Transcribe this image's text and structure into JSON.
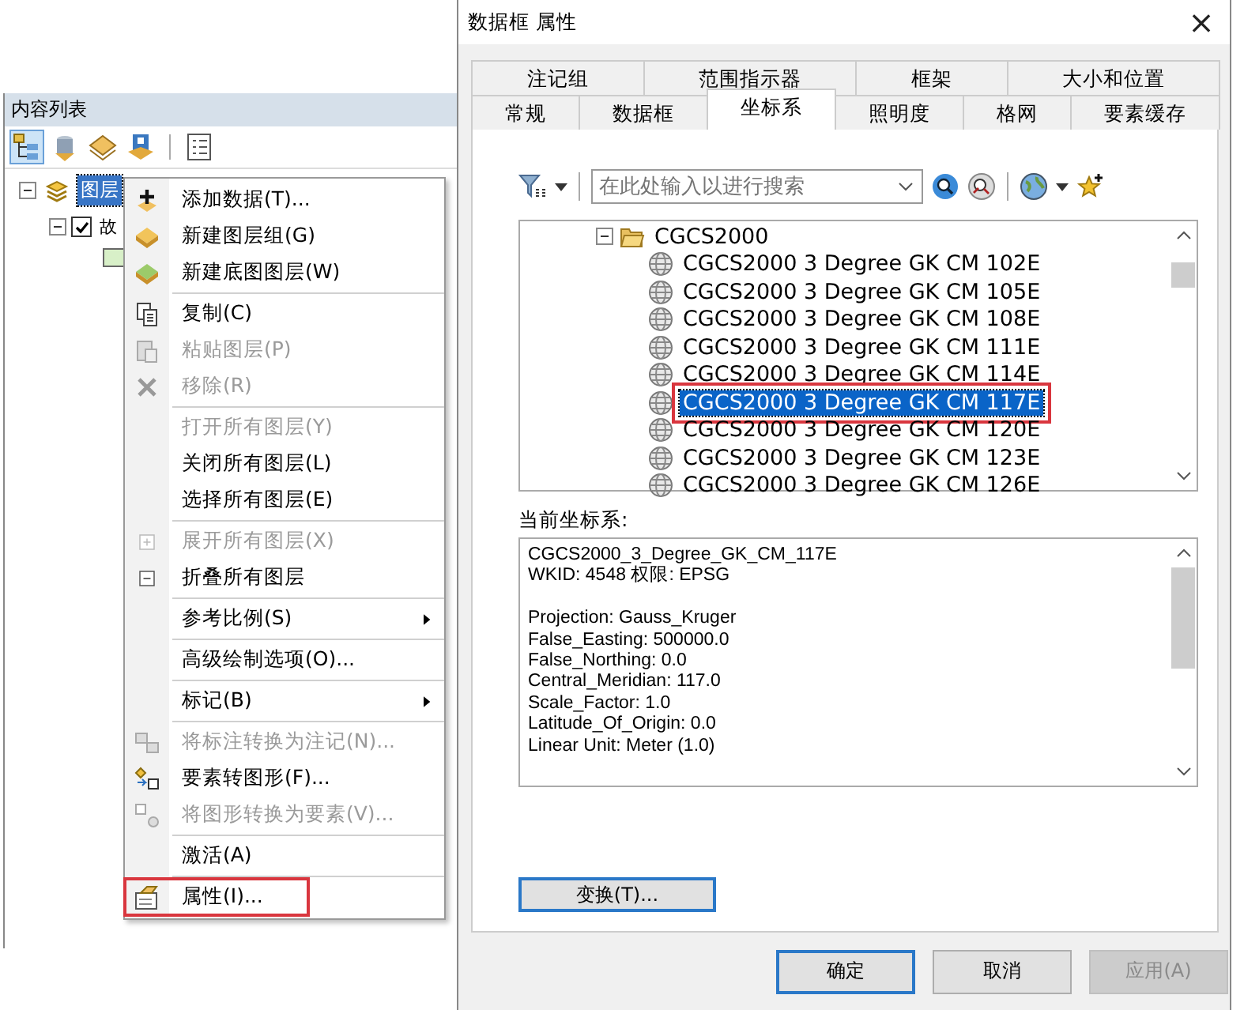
{
  "toc": {
    "title": "内容列表",
    "tree": [
      {
        "label": "图层",
        "selected": true,
        "expanded": true,
        "children": [
          {
            "label": "故",
            "checked": true,
            "expanded": true,
            "color": "#d8f0c8"
          }
        ]
      }
    ]
  },
  "context_menu": [
    {
      "kind": "item",
      "label": "添加数据(T)...",
      "disabled": false
    },
    {
      "kind": "item",
      "label": "新建图层组(G)",
      "disabled": false
    },
    {
      "kind": "item",
      "label": "新建底图图层(W)",
      "disabled": false
    },
    {
      "kind": "separator"
    },
    {
      "kind": "item",
      "label": "复制(C)",
      "disabled": false
    },
    {
      "kind": "item",
      "label": "粘贴图层(P)",
      "disabled": true
    },
    {
      "kind": "item",
      "label": "移除(R)",
      "disabled": true
    },
    {
      "kind": "separator"
    },
    {
      "kind": "item",
      "label": "打开所有图层(Y)",
      "disabled": true
    },
    {
      "kind": "item",
      "label": "关闭所有图层(L)",
      "disabled": false
    },
    {
      "kind": "item",
      "label": "选择所有图层(E)",
      "disabled": false
    },
    {
      "kind": "separator"
    },
    {
      "kind": "item",
      "label": "展开所有图层(X)",
      "disabled": true
    },
    {
      "kind": "item",
      "label": "折叠所有图层",
      "disabled": false
    },
    {
      "kind": "separator"
    },
    {
      "kind": "submenu",
      "label": "参考比例(S)",
      "disabled": false
    },
    {
      "kind": "separator"
    },
    {
      "kind": "item",
      "label": "高级绘制选项(O)...",
      "disabled": false
    },
    {
      "kind": "separator"
    },
    {
      "kind": "submenu",
      "label": "标记(B)",
      "disabled": false
    },
    {
      "kind": "separator"
    },
    {
      "kind": "item",
      "label": "将标注转换为注记(N)...",
      "disabled": true
    },
    {
      "kind": "item",
      "label": "要素转图形(F)...",
      "disabled": false
    },
    {
      "kind": "item",
      "label": "将图形转换为要素(V)...",
      "disabled": true
    },
    {
      "kind": "separator"
    },
    {
      "kind": "item",
      "label": "激活(A)",
      "disabled": false
    },
    {
      "kind": "separator"
    },
    {
      "kind": "item",
      "label": "属性(I)...",
      "disabled": false,
      "highlighted": true
    }
  ],
  "dialog": {
    "title": "数据框 属性",
    "close": "×",
    "tab_rows": [
      [
        {
          "label": "注记组",
          "selected": false
        },
        {
          "label": "范围指示器",
          "selected": false
        },
        {
          "label": "框架",
          "selected": false
        },
        {
          "label": "大小和位置",
          "selected": false
        }
      ],
      [
        {
          "label": "常规",
          "selected": false
        },
        {
          "label": "数据框",
          "selected": false
        },
        {
          "label": "坐标系",
          "selected": true
        },
        {
          "label": "照明度",
          "selected": false
        },
        {
          "label": "格网",
          "selected": false
        },
        {
          "label": "要素缓存",
          "selected": false
        }
      ]
    ],
    "search": {
      "placeholder": "在此处输入以进行搜索"
    },
    "tree": {
      "folder": "CGCS2000",
      "expanded": true,
      "items": [
        {
          "label": "CGCS2000 3 Degree GK CM 102E",
          "selected": false
        },
        {
          "label": "CGCS2000 3 Degree GK CM 105E",
          "selected": false
        },
        {
          "label": "CGCS2000 3 Degree GK CM 108E",
          "selected": false
        },
        {
          "label": "CGCS2000 3 Degree GK CM 111E",
          "selected": false
        },
        {
          "label": "CGCS2000 3 Degree GK CM 114E",
          "selected": false
        },
        {
          "label": "CGCS2000 3 Degree GK CM 117E",
          "selected": true,
          "highlighted": true
        },
        {
          "label": "CGCS2000 3 Degree GK CM 120E",
          "selected": false
        },
        {
          "label": "CGCS2000 3 Degree GK CM 123E",
          "selected": false
        },
        {
          "label": "CGCS2000 3 Degree GK CM 126E",
          "selected": false
        }
      ]
    },
    "current_label": "当前坐标系:",
    "details": [
      [
        "CGCS2000_3_Degree_GK_CM_117E",
        "WKID: 4548 权限: EPSG"
      ],
      [
        "Projection: Gauss_Kruger",
        "False_Easting: 500000.0",
        "False_Northing: 0.0",
        "Central_Meridian: 117.0",
        "Scale_Factor: 1.0",
        "Latitude_Of_Origin: 0.0",
        "Linear Unit: Meter (1.0)"
      ]
    ],
    "transform_button": "变换(T)...",
    "buttons": [
      {
        "label": "确定",
        "disabled": false,
        "default": true
      },
      {
        "label": "取消",
        "disabled": false,
        "default": false
      },
      {
        "label": "应用(A)",
        "disabled": true,
        "default": false
      }
    ]
  }
}
